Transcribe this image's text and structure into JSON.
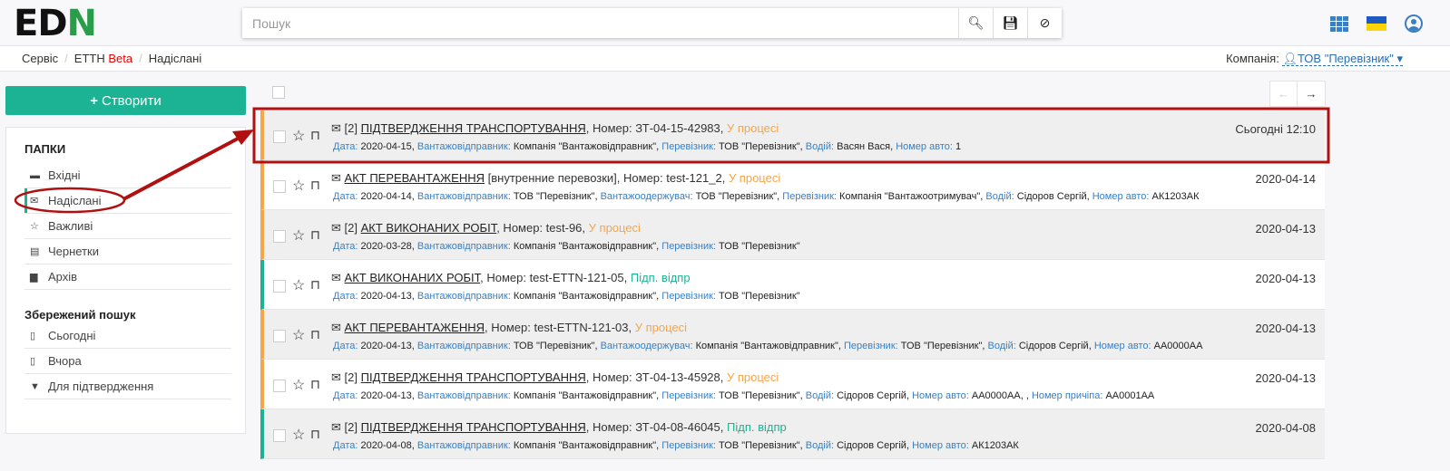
{
  "header": {
    "logo_left": "ED",
    "logo_right": "N",
    "search_placeholder": "Пошук"
  },
  "breadcrumb": {
    "items": [
      "Сервіс",
      "ЕТТН"
    ],
    "beta": "Beta",
    "current": "Надіслані"
  },
  "company": {
    "label": "Компанія:",
    "value": "ТОВ \"Перевізник\""
  },
  "sidebar": {
    "create_label": "Створити",
    "folders_title": "ПАПКИ",
    "folders": [
      {
        "label": "Вхідні",
        "icon": "inbox"
      },
      {
        "label": "Надіслані",
        "icon": "envelope",
        "active": true
      },
      {
        "label": "Важливі",
        "icon": "star"
      },
      {
        "label": "Чернетки",
        "icon": "file"
      },
      {
        "label": "Архів",
        "icon": "archive"
      }
    ],
    "saved_title": "Збережений пошук",
    "saved": [
      {
        "label": "Сьогодні",
        "icon": "file-date"
      },
      {
        "label": "Вчора",
        "icon": "file-date"
      },
      {
        "label": "Для підтвердження",
        "icon": "filter"
      }
    ]
  },
  "colors": {
    "accent": "#1bb394",
    "in_progress": "#f5a54a",
    "annotation": "#b01010"
  },
  "rows": [
    {
      "prefix": "[2]",
      "title": "ПІДТВЕРДЖЕННЯ ТРАНСПОРТУВАННЯ",
      "extra": "",
      "number": ", Номер: ЗТ-04-15-42983,",
      "status": "У процесі",
      "status_type": "proc",
      "date": "Сьогодні 12:10",
      "fields": [
        {
          "l": "Дата:",
          "v": "2020-04-15"
        },
        {
          "l": "Вантажовідправник:",
          "v": "Компанія \"Вантажовідправник\""
        },
        {
          "l": "Перевізник:",
          "v": "ТОВ \"Перевізник\""
        },
        {
          "l": "Водій:",
          "v": "Васян Вася"
        },
        {
          "l": "Номер авто:",
          "v": "1"
        }
      ]
    },
    {
      "prefix": "",
      "title": "АКТ ПЕРЕВАНТАЖЕННЯ",
      "extra": " [внутренние перевозки]",
      "number": ", Номер: test-121_2,",
      "status": "У процесі",
      "status_type": "proc",
      "date": "2020-04-14",
      "fields": [
        {
          "l": "Дата:",
          "v": "2020-04-14"
        },
        {
          "l": "Вантажовідправник:",
          "v": "ТОВ \"Перевізник\""
        },
        {
          "l": "Вантажоодержувач:",
          "v": "ТОВ \"Перевізник\""
        },
        {
          "l": "Перевізник:",
          "v": "Компанія \"Вантажоотримувач\""
        },
        {
          "l": "Водій:",
          "v": "Сідоров Сергій"
        },
        {
          "l": "Номер авто:",
          "v": "АК1203АК"
        }
      ]
    },
    {
      "prefix": "[2]",
      "title": "АКТ ВИКОНАНИХ РОБІТ",
      "extra": "",
      "number": ", Номер: test-96,",
      "status": "У процесі",
      "status_type": "proc",
      "date": "2020-04-13",
      "fields": [
        {
          "l": "Дата:",
          "v": "2020-03-28"
        },
        {
          "l": "Вантажовідправник:",
          "v": "Компанія \"Вантажовідправник\""
        },
        {
          "l": "Перевізник:",
          "v": "ТОВ \"Перевізник\""
        }
      ]
    },
    {
      "prefix": "",
      "title": "АКТ ВИКОНАНИХ РОБІТ",
      "extra": "",
      "number": ", Номер: test-ETTN-121-05,",
      "status": "Підп. відпр",
      "status_type": "ok",
      "date": "2020-04-13",
      "fields": [
        {
          "l": "Дата:",
          "v": "2020-04-13"
        },
        {
          "l": "Вантажовідправник:",
          "v": "Компанія \"Вантажовідправник\""
        },
        {
          "l": "Перевізник:",
          "v": "ТОВ \"Перевізник\""
        }
      ]
    },
    {
      "prefix": "",
      "title": "АКТ ПЕРЕВАНТАЖЕННЯ",
      "extra": "",
      "number": ", Номер: test-ETTN-121-03,",
      "status": "У процесі",
      "status_type": "proc",
      "date": "2020-04-13",
      "fields": [
        {
          "l": "Дата:",
          "v": "2020-04-13"
        },
        {
          "l": "Вантажовідправник:",
          "v": "ТОВ \"Перевізник\""
        },
        {
          "l": "Вантажоодержувач:",
          "v": "Компанія \"Вантажовідправник\""
        },
        {
          "l": "Перевізник:",
          "v": "ТОВ \"Перевізник\""
        },
        {
          "l": "Водій:",
          "v": "Сідоров Сергій"
        },
        {
          "l": "Номер авто:",
          "v": "АА0000АА"
        }
      ]
    },
    {
      "prefix": "[2]",
      "title": "ПІДТВЕРДЖЕННЯ ТРАНСПОРТУВАННЯ",
      "extra": "",
      "number": ", Номер: ЗТ-04-13-45928,",
      "status": "У процесі",
      "status_type": "proc",
      "date": "2020-04-13",
      "fields": [
        {
          "l": "Дата:",
          "v": "2020-04-13"
        },
        {
          "l": "Вантажовідправник:",
          "v": "Компанія \"Вантажовідправник\""
        },
        {
          "l": "Перевізник:",
          "v": "ТОВ \"Перевізник\""
        },
        {
          "l": "Водій:",
          "v": "Сідоров Сергій"
        },
        {
          "l": "Номер авто:",
          "v": "АА0000АА, "
        },
        {
          "l": "Номер причіпа:",
          "v": "АА0001АА"
        }
      ]
    },
    {
      "prefix": "[2]",
      "title": "ПІДТВЕРДЖЕННЯ ТРАНСПОРТУВАННЯ",
      "extra": "",
      "number": ", Номер: ЗТ-04-08-46045,",
      "status": "Підп. відпр",
      "status_type": "ok",
      "date": "2020-04-08",
      "fields": [
        {
          "l": "Дата:",
          "v": "2020-04-08"
        },
        {
          "l": "Вантажовідправник:",
          "v": "Компанія \"Вантажовідправник\""
        },
        {
          "l": "Перевізник:",
          "v": "ТОВ \"Перевізник\""
        },
        {
          "l": "Водій:",
          "v": "Сідоров Сергій"
        },
        {
          "l": "Номер авто:",
          "v": "АК1203АК"
        }
      ]
    }
  ]
}
